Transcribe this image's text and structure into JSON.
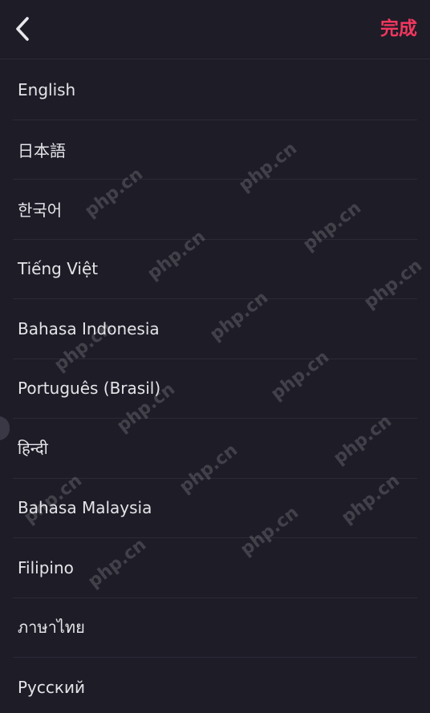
{
  "header": {
    "back_icon": "chevron-left-icon",
    "done_label": "完成",
    "accent_color": "#f2375f"
  },
  "languages": [
    {
      "label": "English"
    },
    {
      "label": "日本語"
    },
    {
      "label": "한국어"
    },
    {
      "label": "Tiếng Việt"
    },
    {
      "label": "Bahasa Indonesia"
    },
    {
      "label": "Português (Brasil)"
    },
    {
      "label": "हिन्दी"
    },
    {
      "label": "Bahasa Malaysia"
    },
    {
      "label": "Filipino"
    },
    {
      "label": "ภาษาไทย"
    },
    {
      "label": "Русский"
    }
  ],
  "watermark": {
    "text": "php.cn"
  }
}
